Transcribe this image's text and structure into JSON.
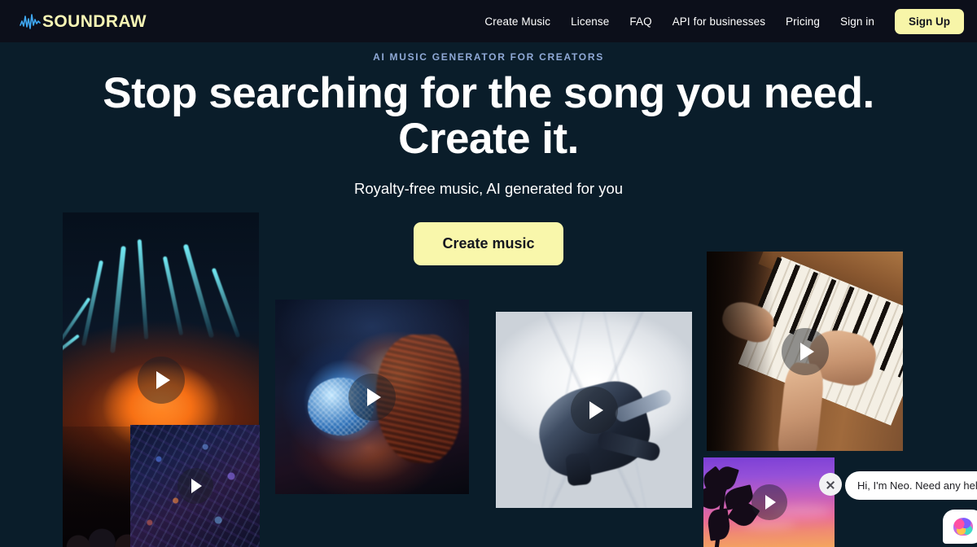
{
  "brand": {
    "name": "SOUNDRAW",
    "logo_icon": "soundwave-icon",
    "logo_color": "#f7f5b5",
    "wave_color": "#3fa9f5"
  },
  "nav": {
    "links": [
      {
        "label": "Create Music"
      },
      {
        "label": "License"
      },
      {
        "label": "FAQ"
      },
      {
        "label": "API for businesses"
      },
      {
        "label": "Pricing"
      },
      {
        "label": "Sign in"
      }
    ],
    "signup_label": "Sign Up",
    "signup_color": "#f7f5a8",
    "background": "#0c0f1a"
  },
  "hero": {
    "eyebrow": "AI MUSIC GENERATOR FOR CREATORS",
    "eyebrow_color": "#8fa9d6",
    "headline_line1": "Stop searching for the song you need.",
    "headline_line2": "Create it.",
    "subtitle": "Royalty-free music, AI generated for you",
    "cta_label": "Create music",
    "cta_color": "#f9f7ab",
    "background": "#0a1d2a"
  },
  "gallery": {
    "play_icon": "play-icon",
    "cards": [
      {
        "name": "concert-lasers",
        "alt": "Concert with cyan laser beams over a crowd"
      },
      {
        "name": "city-night",
        "alt": "Aerial night cityscape with neon lights"
      },
      {
        "name": "disco-ball",
        "alt": "Woman with a mirrored disco ball"
      },
      {
        "name": "breakdancer",
        "alt": "Breakdancer in a bright white corridor"
      },
      {
        "name": "piano-hands",
        "alt": "Hands playing a wooden upright piano"
      },
      {
        "name": "palm-sunset",
        "alt": "Palm trees against a purple sunset sky"
      }
    ]
  },
  "chat": {
    "message": "Hi, I'm Neo. Need any help?",
    "close_icon": "close-icon",
    "launcher_icon": "ai-brain-icon"
  }
}
